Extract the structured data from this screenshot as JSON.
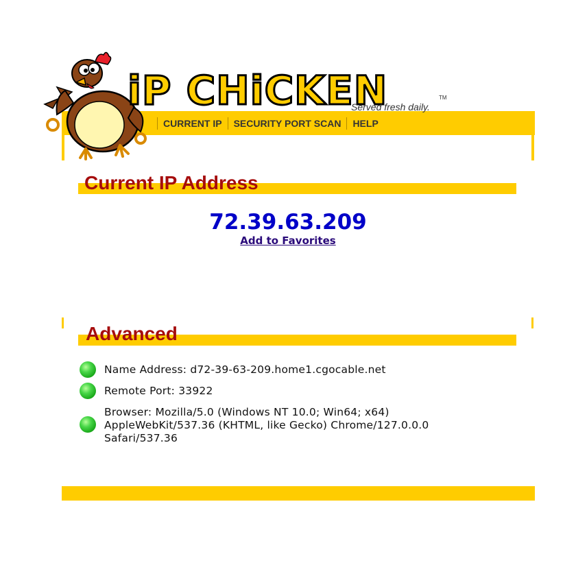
{
  "logo": {
    "wordmark": "iP CHiCKEN",
    "tagline": "Served fresh daily.",
    "trademark": "TM"
  },
  "nav": [
    {
      "label": "CURRENT IP"
    },
    {
      "label": "SECURITY PORT SCAN"
    },
    {
      "label": "HELP"
    }
  ],
  "current_ip": {
    "heading": "Current IP Address",
    "ip": "72.39.63.209",
    "favorites_link": "Add to Favorites"
  },
  "advanced": {
    "heading": "Advanced",
    "rows": [
      {
        "lines": [
          "Name Address: d72-39-63-209.home1.cgocable.net"
        ]
      },
      {
        "lines": [
          "Remote Port: 33922"
        ]
      },
      {
        "lines": [
          "Browser: Mozilla/5.0 (Windows NT 10.0; Win64; x64)",
          "AppleWebKit/537.36 (KHTML, like Gecko) Chrome/127.0.0.0",
          "Safari/537.36"
        ]
      }
    ]
  },
  "colors": {
    "accent_yellow": "#ffcc00",
    "heading_red": "#a60d0d",
    "ip_blue": "#0000c8",
    "bullet_green": "#22b022"
  }
}
